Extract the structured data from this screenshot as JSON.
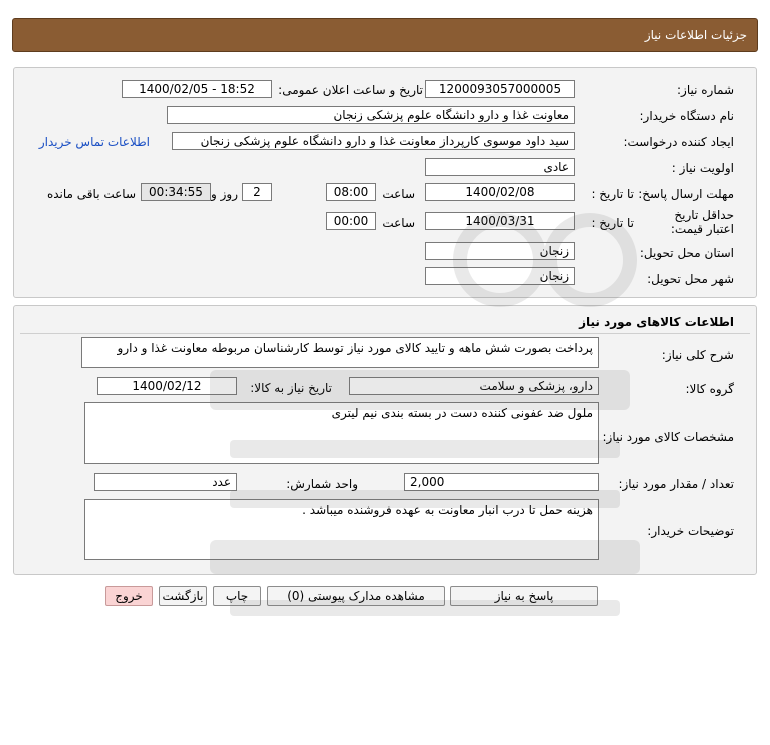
{
  "header": {
    "title": "جزئیات اطلاعات نیاز"
  },
  "info": {
    "need_number_label": "شماره نیاز:",
    "need_number": "1200093057000005",
    "announce_label": "تاریخ و ساعت اعلان عمومی:",
    "announce_value": "1400/02/05 - 18:52",
    "buyer_org_label": "نام دستگاه خریدار:",
    "buyer_org": "معاونت غذا و دارو دانشگاه علوم پزشکی زنجان",
    "requester_label": "ایجاد کننده درخواست:",
    "requester": "سید داود موسوی کارپرداز معاونت غذا و دارو دانشگاه علوم پزشکی زنجان",
    "contact_link": "اطلاعات تماس خریدار",
    "priority_label": "اولویت نیاز :",
    "priority": "عادی",
    "deadline_label": "مهلت ارسال پاسخ:",
    "until_date_label": "تا تاریخ :",
    "deadline_date": "1400/02/08",
    "time_label": "ساعت",
    "deadline_time": "08:00",
    "days_value": "2",
    "days_label": "روز و",
    "remaining_time": "00:34:55",
    "remaining_label": "ساعت باقی مانده",
    "validity_label": "حداقل تاریخ اعتبار قیمت:",
    "validity_until_label": "تا تاریخ :",
    "validity_date": "1400/03/31",
    "validity_time_label": "ساعت",
    "validity_time": "00:00",
    "province_label": "استان محل تحویل:",
    "province": "زنجان",
    "city_label": "شهر محل تحویل:",
    "city": "زنجان"
  },
  "goods": {
    "section_title": "اطلاعات کالاهای مورد نیاز",
    "general_desc_label": "شرح کلی نیاز:",
    "general_desc": "پرداخت بصورت شش ماهه و تایید کالای مورد نیاز توسط کارشناسان مربوطه معاونت غذا و دارو",
    "group_label": "گروه کالا:",
    "group": "دارو، پزشکی و سلامت",
    "need_date_label": "تاریخ نیاز به کالا:",
    "need_date": "1400/02/12",
    "specs_label": "مشخصات کالای مورد نیاز:",
    "specs": "ملول ضد عفونی کننده دست در بسته بندی نیم لیتری",
    "qty_label": "تعداد / مقدار مورد نیاز:",
    "qty": "2,000",
    "unit_label": "واحد شمارش:",
    "unit": "عدد",
    "buyer_notes_label": "توضیحات خریدار:",
    "buyer_notes": "هزینه حمل تا درب انبار معاونت به عهده فروشنده میباشد ."
  },
  "actions": {
    "reply": "پاسخ به نیاز",
    "attachments": "مشاهده مدارک پیوستی (0)",
    "print": "چاپ",
    "back": "بازگشت",
    "exit": "خروج"
  },
  "colors": {
    "title_bar": "#8a5c33",
    "link": "#1a4fc4",
    "exit_button": "#fad4d4"
  }
}
